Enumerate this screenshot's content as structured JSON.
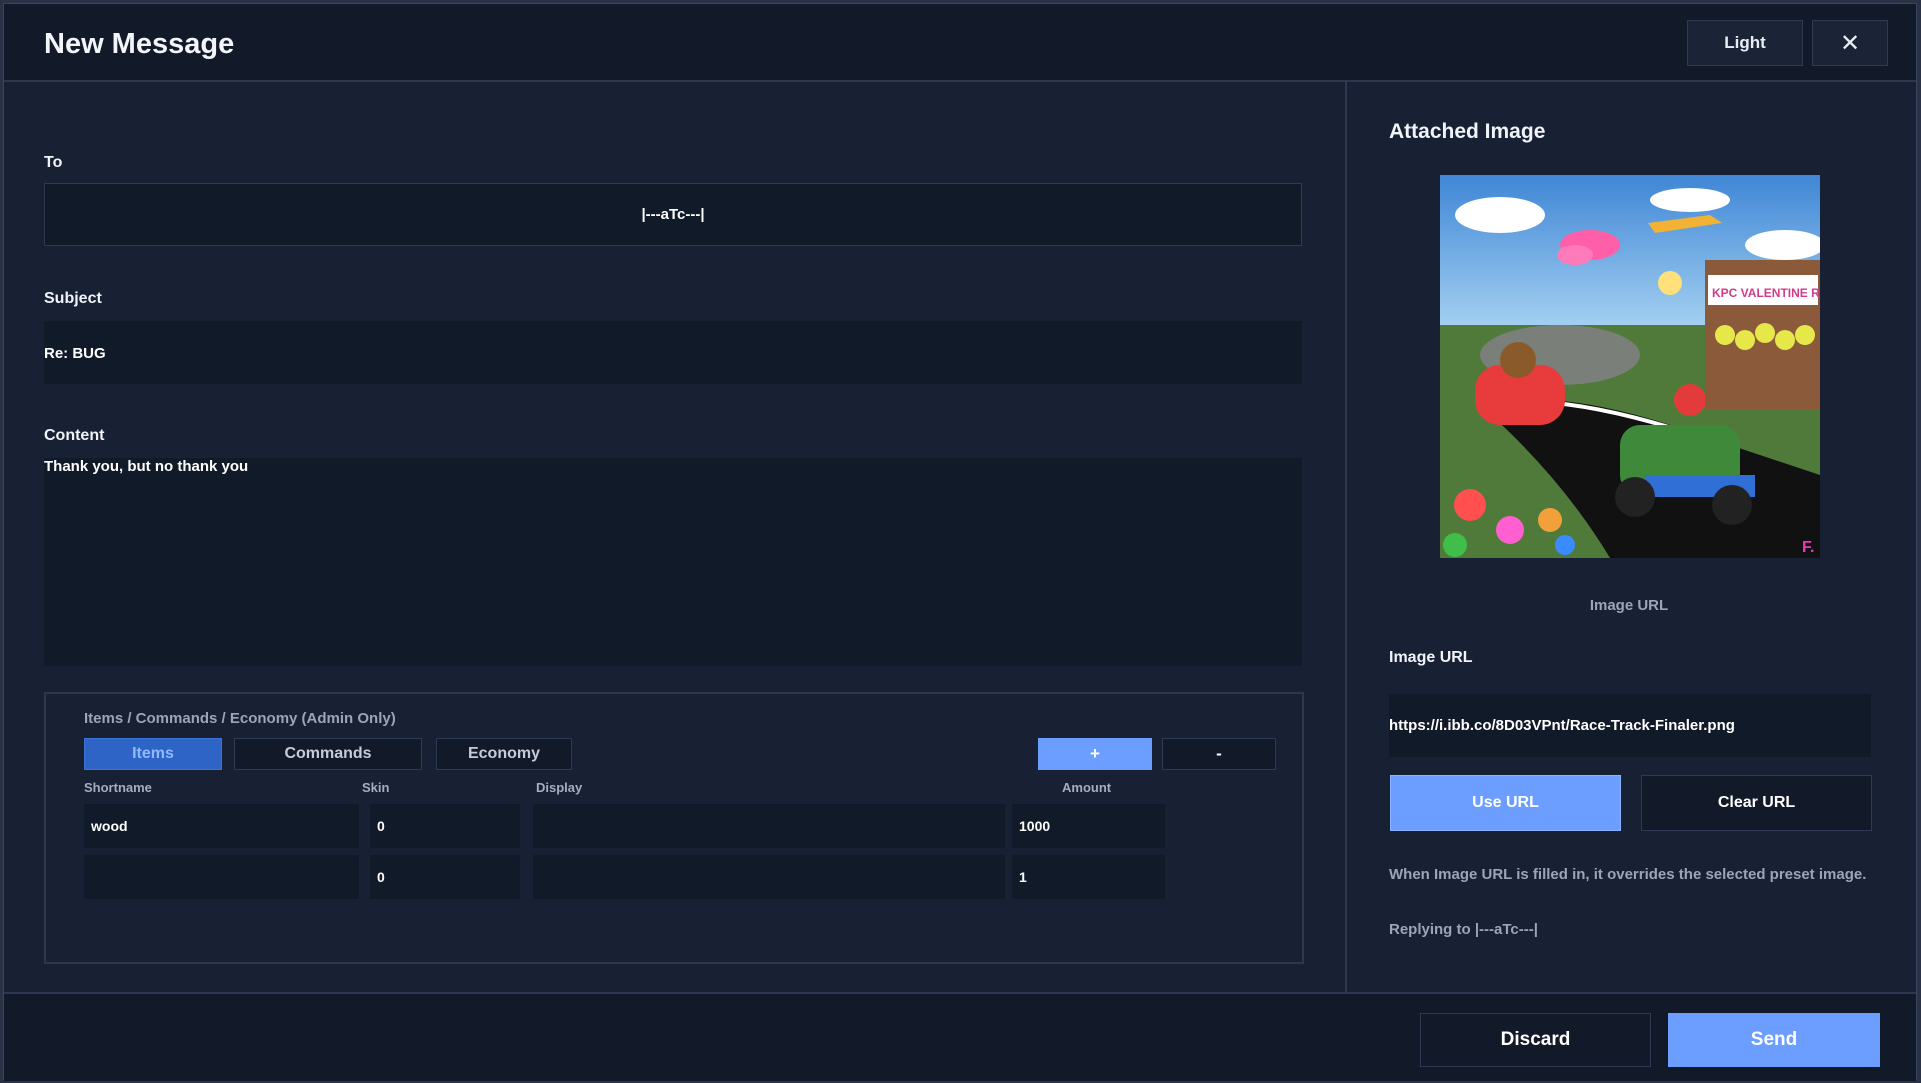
{
  "header": {
    "title": "New Message",
    "light_label": "Light",
    "close_glyph": "✕"
  },
  "to": {
    "label": "To",
    "value": "|---aTc---|"
  },
  "subject": {
    "label": "Subject",
    "value": "Re: BUG"
  },
  "content": {
    "label": "Content",
    "value": "Thank you, but no thank you"
  },
  "items_panel": {
    "title": "Items / Commands / Economy (Admin Only)",
    "tabs": [
      "Items",
      "Commands",
      "Economy"
    ],
    "active_tab": "Items",
    "plus_label": "+",
    "minus_label": "-",
    "columns": [
      "Shortname",
      "Skin",
      "Display",
      "Amount"
    ],
    "rows": [
      {
        "shortname": "wood",
        "skin": "0",
        "display": "",
        "amount": "1000"
      },
      {
        "shortname": "",
        "skin": "0",
        "display": "",
        "amount": "1"
      }
    ]
  },
  "attachment": {
    "title": "Attached Image",
    "image_caption": "Image URL",
    "url_label": "Image URL",
    "url_value": "https://i.ibb.co/8D03VPnt/Race-Track-Finaler.png",
    "use_url_label": "Use URL",
    "clear_url_label": "Clear URL",
    "note": "When Image URL is filled in, it overrides the selected preset image.",
    "reply_text": "Replying to |---aTc---|",
    "image_sign_text": "KPC VALENTINE RACE",
    "image_corner_mark": "F."
  },
  "footer": {
    "discard_label": "Discard",
    "send_label": "Send"
  },
  "colors": {
    "accent": "#6b9eff",
    "background": "#172133",
    "field": "#111a29"
  }
}
